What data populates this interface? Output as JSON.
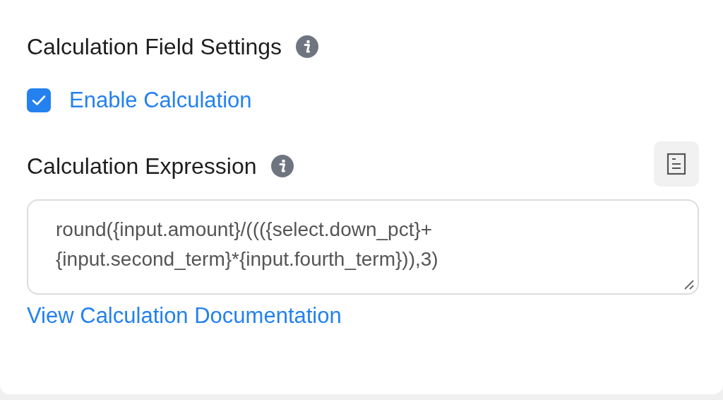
{
  "title": "Calculation Field Settings",
  "enable": {
    "label": "Enable Calculation",
    "checked": true
  },
  "expression": {
    "label": "Calculation Expression",
    "value": "round({input.amount}/((({select.down_pct}+\n{input.second_term}*{input.fourth_term})),3)"
  },
  "link": "View Calculation Documentation"
}
